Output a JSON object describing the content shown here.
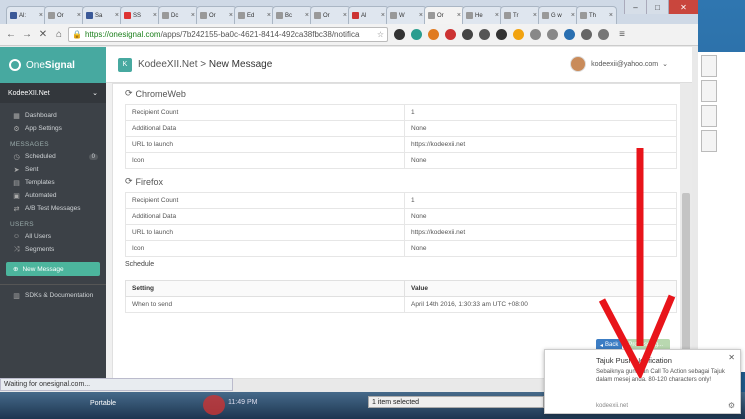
{
  "browser": {
    "tabs": [
      {
        "label": "Al:",
        "fav": "#3b5998"
      },
      {
        "label": "Or",
        "fav": "#999"
      },
      {
        "label": "Sa",
        "fav": "#3b5998"
      },
      {
        "label": "SS",
        "fav": "#d33"
      },
      {
        "label": "Dc",
        "fav": "#999"
      },
      {
        "label": "Or",
        "fav": "#999"
      },
      {
        "label": "Ed",
        "fav": "#999"
      },
      {
        "label": "Bc",
        "fav": "#999"
      },
      {
        "label": "Or",
        "fav": "#999"
      },
      {
        "label": "Al",
        "fav": "#c33"
      },
      {
        "label": "W",
        "fav": "#999"
      },
      {
        "label": "Or",
        "fav": "#999"
      },
      {
        "label": "He",
        "fav": "#999"
      },
      {
        "label": "Tr",
        "fav": "#999"
      },
      {
        "label": "G w",
        "fav": "#999"
      },
      {
        "label": "Th",
        "fav": "#999"
      }
    ],
    "url_host": "https://onesignal.com",
    "url_path": "/apps/7b242155-ba0c-4621-8414-492ca38fbc38/notifica",
    "status_text": "Waiting for onesignal.com..."
  },
  "sidebar": {
    "brand_prefix": "One",
    "brand_bold": "Signal",
    "app_name": "KodeeXII.Net",
    "items_top": [
      {
        "label": "Dashboard",
        "icon": "dashboard-icon",
        "glyph": "▦"
      },
      {
        "label": "App Settings",
        "icon": "settings-icon",
        "glyph": "⚙"
      }
    ],
    "messages_head": "MESSAGES",
    "messages": [
      {
        "label": "Scheduled",
        "icon": "clock-icon",
        "glyph": "◷",
        "count": "0"
      },
      {
        "label": "Sent",
        "icon": "send-icon",
        "glyph": "➤"
      },
      {
        "label": "Templates",
        "icon": "template-icon",
        "glyph": "▤"
      },
      {
        "label": "Automated",
        "icon": "automated-icon",
        "glyph": "▣"
      },
      {
        "label": "A/B Test Messages",
        "icon": "ab-test-icon",
        "glyph": "⇄"
      }
    ],
    "users_head": "USERS",
    "users": [
      {
        "label": "All Users",
        "icon": "users-icon",
        "glyph": "☺"
      },
      {
        "label": "Segments",
        "icon": "segments-icon",
        "glyph": "⤨"
      }
    ],
    "new_message": "New Message",
    "sdks": "SDKs & Documentation"
  },
  "topbar": {
    "badge": "K",
    "app": "KodeeXII.Net",
    "sep": ">",
    "page": "New Message",
    "user_email": "kodeexii@yahoo.com"
  },
  "chromeweb": {
    "title": "ChromeWeb",
    "rows": [
      {
        "k": "Recipient Count",
        "v": "1"
      },
      {
        "k": "Additional Data",
        "v": "None"
      },
      {
        "k": "URL to launch",
        "v": "https://kodeexii.net"
      },
      {
        "k": "Icon",
        "v": "None"
      }
    ]
  },
  "firefox": {
    "title": "Firefox",
    "rows": [
      {
        "k": "Recipient Count",
        "v": "1"
      },
      {
        "k": "Additional Data",
        "v": "None"
      },
      {
        "k": "URL to launch",
        "v": "https://kodeexii.net"
      },
      {
        "k": "Icon",
        "v": "None"
      }
    ]
  },
  "schedule": {
    "label": "Schedule",
    "col_setting": "Setting",
    "col_value": "Value",
    "row_setting": "When to send",
    "row_value": "April 14th 2016, 1:30:33 am UTC +08:00"
  },
  "actions": {
    "back": "Back",
    "send": "Processing..."
  },
  "notification": {
    "title": "Tajuk Push Notification",
    "body": "Sebaiknya gunakan Call To Action sebagai Tajuk dalam mesej anda. 80-120 characters only!",
    "site": "kodeexii.net"
  },
  "taskbar": {
    "label": "Portable",
    "time": "11:49 PM",
    "explorer_status": "1 item selected"
  },
  "colors": {
    "accent": "#47a9a0",
    "sidebar": "#3c4147",
    "arrow": "#e8141a"
  }
}
